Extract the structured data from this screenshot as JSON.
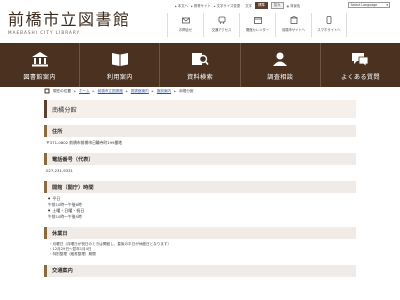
{
  "header": {
    "logo_jp": "前橋市立図書館",
    "logo_en": "MAEBASHI CITY LIBRARY",
    "util_links": [
      "本文へ",
      "携帯サイト",
      "文字サイズ変更"
    ],
    "font_size_label": "文字",
    "font_size_buttons": [
      "標準",
      "拡大"
    ],
    "bg_label": "背景色",
    "language_select": "Select Language"
  },
  "quick_links": [
    {
      "label": "お問合せ",
      "icon": "mail-icon"
    },
    {
      "label": "交通アクセス",
      "icon": "access-icon"
    },
    {
      "label": "開館カレンダー",
      "icon": "calendar-icon"
    },
    {
      "label": "前橋市サイトへ",
      "icon": "city-icon"
    },
    {
      "label": "スマホサイトへ",
      "icon": "smartphone-icon"
    }
  ],
  "nav": [
    {
      "label": "図書館案内",
      "icon": "library-building-icon"
    },
    {
      "label": "利用案内",
      "icon": "book-icon"
    },
    {
      "label": "資料検索",
      "icon": "book-search-icon"
    },
    {
      "label": "調査相談",
      "icon": "consultation-icon"
    },
    {
      "label": "よくある質問",
      "icon": "faq-icon"
    }
  ],
  "breadcrumb": {
    "label": "現在の位置",
    "items": [
      "ホーム",
      "前橋市立図書館",
      "図書館案内",
      "施設案内"
    ],
    "current": "南橘分館"
  },
  "page": {
    "title": "南橘分館",
    "sections": {
      "address": {
        "heading": "住所",
        "text": "〒371-0802 前橋市前橋市日輪寺町199番地"
      },
      "phone": {
        "heading": "電話番号（代表）",
        "text": "027-231-9331"
      },
      "hours": {
        "heading": "開館（開庁）時間",
        "weekday_label": "平日",
        "weekday_value": "午前10時～午後6時",
        "weekend_label": "土曜・日曜・祝日",
        "weekend_value": "午前10時～午後5時"
      },
      "closed": {
        "heading": "休業日",
        "items": [
          "月曜日（月曜日が祝日のときは開館し、直後の平日が休館日となります）",
          "12月29日～翌年1月4日",
          "特別整理（蔵書整理）期間"
        ]
      },
      "transport": {
        "heading": "交通案内"
      }
    }
  },
  "colors": {
    "nav_bg": "#4b3220",
    "title_bar": "#f5f0eb",
    "accent": "#8b6a3e"
  }
}
